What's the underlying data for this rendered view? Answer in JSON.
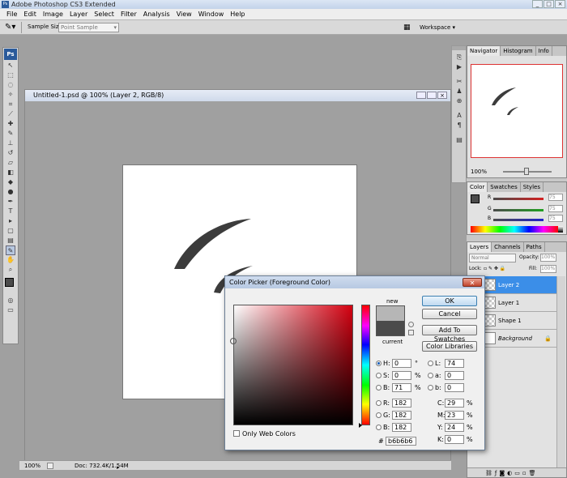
{
  "app": {
    "title": "Adobe Photoshop CS3 Extended",
    "ps_logo": "Ps",
    "window_controls": [
      "minimize-icon",
      "maximize-icon",
      "close-icon"
    ]
  },
  "menu": [
    "File",
    "Edit",
    "Image",
    "Layer",
    "Select",
    "Filter",
    "Analysis",
    "View",
    "Window",
    "Help"
  ],
  "options_bar": {
    "sample_size_label": "Sample Size:",
    "sample_size_value": "Point Sample",
    "workspace_label": "Workspace"
  },
  "document": {
    "title": "Untitled-1.psd @ 100% (Layer 2, RGB/8)",
    "zoom": "100%",
    "doc_info": "Doc: 732.4K/1.54M"
  },
  "navigator": {
    "tabs": [
      "Navigator",
      "Histogram",
      "Info"
    ],
    "zoom": "100%"
  },
  "color_panel": {
    "tabs": [
      "Color",
      "Swatches",
      "Styles"
    ],
    "channels": [
      {
        "label": "R",
        "value": "75",
        "color": "#d42020"
      },
      {
        "label": "G",
        "value": "75",
        "color": "#20a020"
      },
      {
        "label": "B",
        "value": "75",
        "color": "#2020c8"
      }
    ]
  },
  "layers_panel": {
    "tabs": [
      "Layers",
      "Channels",
      "Paths"
    ],
    "blend_mode": "Normal",
    "opacity_label": "Opacity:",
    "opacity": "100%",
    "lock_label": "Lock:",
    "fill_label": "Fill:",
    "fill": "100%",
    "layers": [
      {
        "name": "Layer 2",
        "selected": true
      },
      {
        "name": "Layer 1",
        "selected": false
      },
      {
        "name": "Shape 1",
        "selected": false
      },
      {
        "name": "Background",
        "selected": false
      }
    ]
  },
  "color_picker": {
    "title": "Color Picker (Foreground Color)",
    "ok": "OK",
    "cancel": "Cancel",
    "add_to_swatches": "Add To Swatches",
    "color_libraries": "Color Libraries",
    "new_label": "new",
    "current_label": "current",
    "new_color": "#b6b6b6",
    "current_color": "#4b4b4b",
    "only_web_colors": "Only Web Colors",
    "hsb": [
      {
        "label": "H:",
        "value": "0",
        "unit": "°",
        "checked": true
      },
      {
        "label": "S:",
        "value": "0",
        "unit": "%",
        "checked": false
      },
      {
        "label": "B:",
        "value": "71",
        "unit": "%",
        "checked": false
      }
    ],
    "rgb": [
      {
        "label": "R:",
        "value": "182",
        "checked": false
      },
      {
        "label": "G:",
        "value": "182",
        "checked": false
      },
      {
        "label": "B:",
        "value": "182",
        "checked": false
      }
    ],
    "lab": [
      {
        "label": "L:",
        "value": "74",
        "checked": false
      },
      {
        "label": "a:",
        "value": "0",
        "checked": false
      },
      {
        "label": "b:",
        "value": "0",
        "checked": false
      }
    ],
    "cmyk": [
      {
        "label": "C:",
        "value": "29",
        "unit": "%"
      },
      {
        "label": "M:",
        "value": "23",
        "unit": "%"
      },
      {
        "label": "Y:",
        "value": "24",
        "unit": "%"
      },
      {
        "label": "K:",
        "value": "0",
        "unit": "%"
      }
    ],
    "hex_label": "#",
    "hex": "b6b6b6"
  }
}
